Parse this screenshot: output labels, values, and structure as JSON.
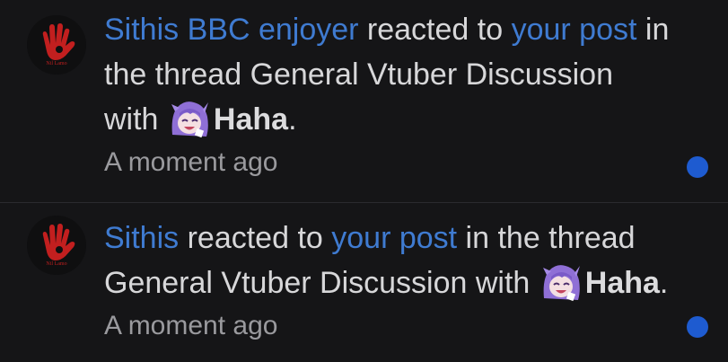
{
  "notifications": [
    {
      "user": "Sithis BBC enjoyer",
      "reacted_text": " reacted to ",
      "post_link": "your post",
      "after_post": " in",
      "line2": "the thread General Vtuber Discussion",
      "with_text": "with",
      "reaction": "Haha",
      "period": ".",
      "time": "A moment ago",
      "avatar_icon": "red-hand-logo-icon",
      "reaction_icon": "vtuber-laughing-face-icon",
      "unread": true
    },
    {
      "user": "Sithis",
      "reacted_text": " reacted to ",
      "post_link": "your post",
      "after_post": " in the thread",
      "line2": "General Vtuber Discussion with",
      "reaction": "Haha",
      "period": ".",
      "time": "A moment ago",
      "avatar_icon": "red-hand-logo-icon",
      "reaction_icon": "vtuber-laughing-face-icon",
      "unread": true
    }
  ],
  "colors": {
    "background": "#151517",
    "link": "#3f7bd1",
    "text": "#d7d7d9",
    "muted": "#9a9a9e",
    "unread_dot": "#1e5bd0",
    "hand": "#c21f1f"
  }
}
